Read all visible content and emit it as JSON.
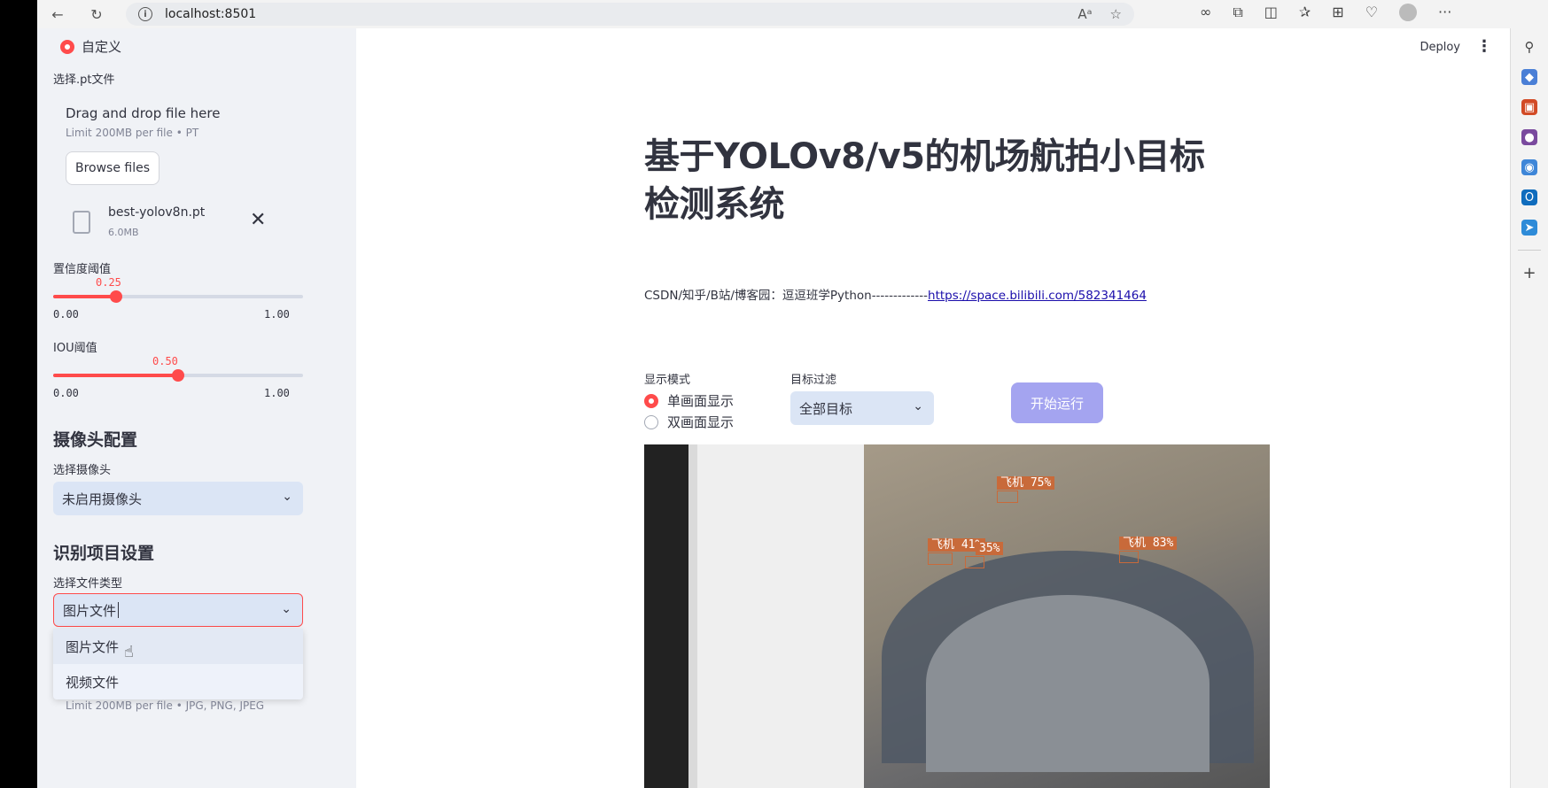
{
  "browser": {
    "url": "localhost:8501"
  },
  "app": {
    "deploy_label": "Deploy",
    "menu_label": "⋮"
  },
  "sidebar": {
    "mode_radio_label": "自定义",
    "model_file_label": "选择.pt文件",
    "uploader_title": "Drag and drop file here",
    "uploader_limit": "Limit 200MB per file • PT",
    "browse_label": "Browse files",
    "file_name": "best-yolov8n.pt",
    "file_size": "6.0MB",
    "confidence": {
      "label": "置信度阈值",
      "value": 0.25,
      "value_text": "0.25",
      "min": "0.00",
      "max": "1.00"
    },
    "iou": {
      "label": "IOU阈值",
      "value": 0.5,
      "value_text": "0.50",
      "min": "0.00",
      "max": "1.00"
    },
    "camera_section": "摄像头配置",
    "camera_select_label": "选择摄像头",
    "camera_value": "未启用摄像头",
    "recognition_section": "识别项目设置",
    "file_type_label": "选择文件类型",
    "file_type_value": "图片文件",
    "file_type_options": [
      "图片文件",
      "视频文件"
    ],
    "file_footer": "Limit 200MB per file • JPG, PNG, JPEG"
  },
  "main": {
    "title": "基于YOLOv8/v5的机场航拍小目标检测系统",
    "credit_text": "CSDN/知乎/B站/博客园：逗逗班学Python-------------",
    "credit_link": "https://space.bilibili.com/582341464",
    "display_mode_label": "显示模式",
    "display_options": [
      "单画面显示",
      "双画面显示"
    ],
    "target_filter_label": "目标过滤",
    "target_filter_value": "全部目标",
    "run_button": "开始运行",
    "detections": [
      "飞机 75%",
      "飞机 41%",
      "35%",
      "飞机 83%"
    ]
  },
  "colors": {
    "accent": "#ff4b4b",
    "sidebar_bg": "#f0f2f6",
    "select_bg": "#dbe5f5",
    "run_button": "#a4a4f0",
    "detection": "#c86a3a"
  }
}
